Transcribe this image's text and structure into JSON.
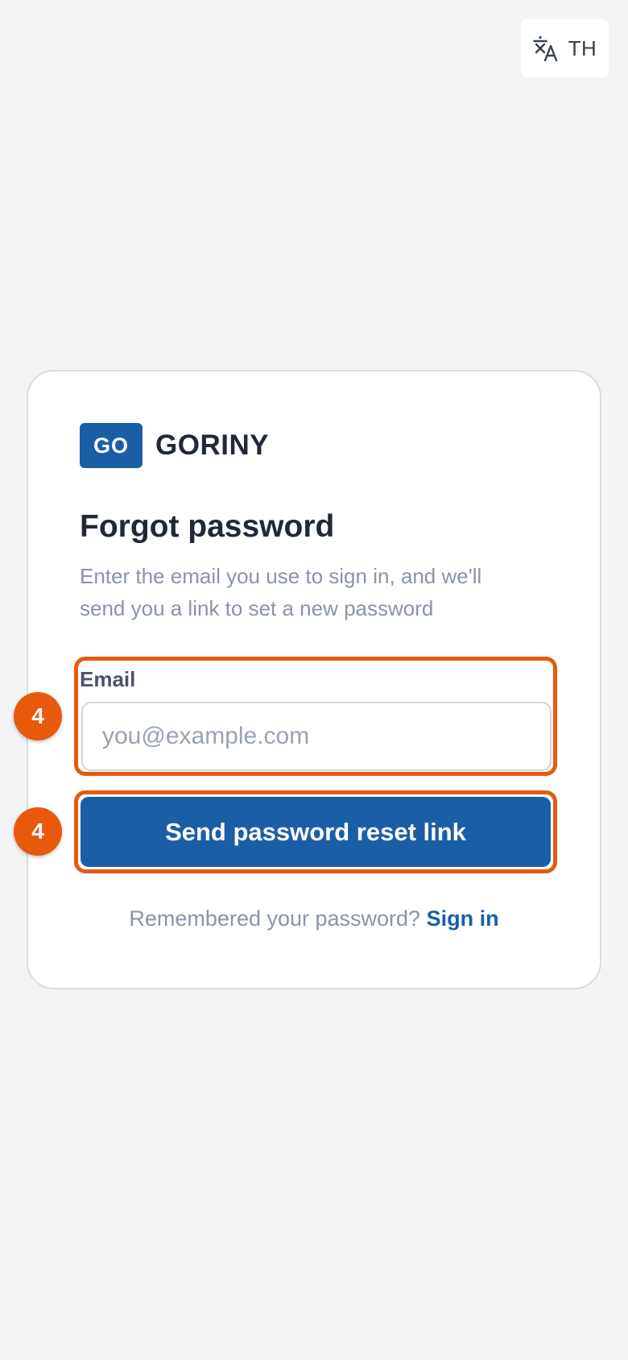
{
  "language_button": {
    "icon": "translate-icon",
    "label": "TH"
  },
  "brand": {
    "logo_text": "GO",
    "name": "GORINY",
    "color": "#1a5fa6"
  },
  "form": {
    "title": "Forgot password",
    "subtitle": "Enter the email you use to sign in, and we'll send you a link to set a new password",
    "email_label": "Email",
    "email_placeholder": "you@example.com",
    "email_value": "",
    "submit_label": "Send password reset link"
  },
  "footer": {
    "text": "Remembered your password?",
    "link_label": "Sign in"
  },
  "annotations": {
    "step_badges": [
      "4",
      "4"
    ],
    "highlight_color": "#e8590c"
  }
}
